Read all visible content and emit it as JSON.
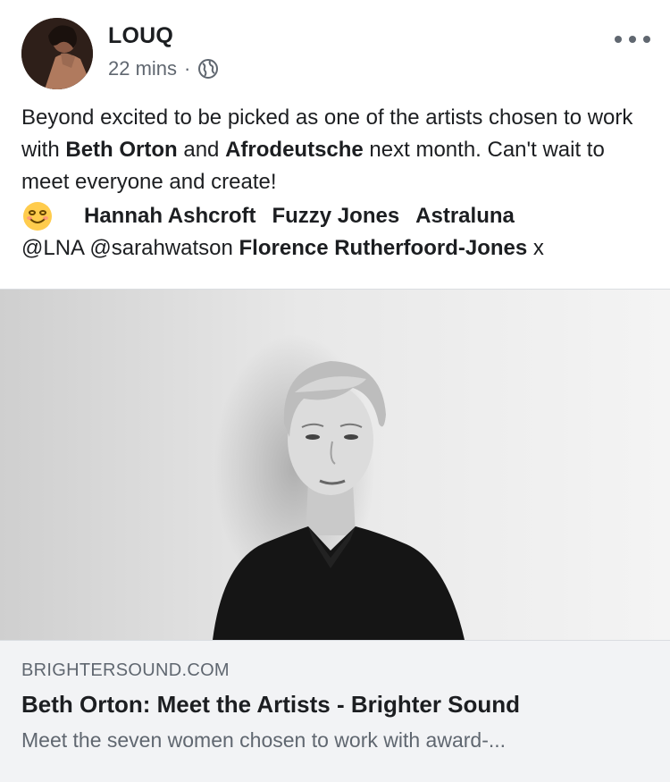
{
  "post": {
    "author": "LOUQ",
    "time": "22 mins",
    "separator": "·",
    "privacy_icon": "globe-icon",
    "more_icon": "more-dots-icon",
    "text": {
      "line1_a": "Beyond excited to be picked as one of the artists chosen to work with ",
      "mention_1": "Beth Orton",
      "line1_b": " and ",
      "mention_2": "Afrodeutsche",
      "line1_c": " next month. Can't wait to meet everyone and create!"
    },
    "tags": {
      "emoji": "smiling-face-emoji",
      "tag_1": "Hannah Ashcroft",
      "tag_2": "Fuzzy Jones",
      "tag_3": "Astraluna",
      "tag_4": "@LNA @sarahwatson",
      "tag_5": "Florence Rutherfoord-Jones",
      "tail": " x"
    }
  },
  "link": {
    "domain": "BRIGHTERSOUND.COM",
    "title": "Beth Orton: Meet the Artists - Brighter Sound",
    "description": "Meet the seven women chosen to work with award-..."
  },
  "colors": {
    "text": "#1c1e21",
    "secondary": "#606770",
    "card_bg": "#f2f3f5",
    "divider": "#dadde1"
  }
}
